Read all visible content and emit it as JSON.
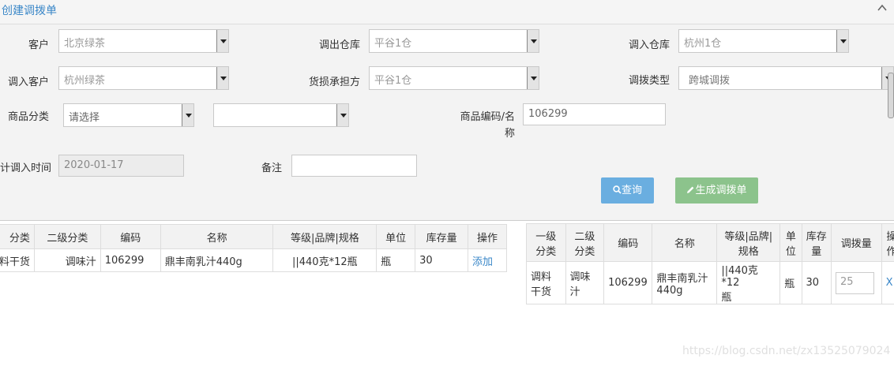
{
  "panel": {
    "title": "创建调拨单",
    "collapse_icon": "chevron-up-icon"
  },
  "form": {
    "customer": {
      "label": "客户",
      "value": "北京绿茶"
    },
    "out_warehouse": {
      "label": "调出仓库",
      "value": "平谷1仓"
    },
    "in_warehouse": {
      "label": "调入仓库",
      "value": "杭州1仓"
    },
    "in_customer": {
      "label": "调入客户",
      "value": "杭州绿茶"
    },
    "loss_bearer": {
      "label": "货损承担方",
      "value": "平谷1仓"
    },
    "transfer_type": {
      "label": "调拨类型",
      "value": "跨城调拨"
    },
    "category": {
      "label": "商品分类",
      "value": "请选择",
      "sub_value": ""
    },
    "code_name": {
      "label_line1": "商品编码/名",
      "label_line2": "称",
      "value": "106299"
    },
    "plan_time": {
      "label": "计调入时间",
      "value": "2020-01-17"
    },
    "remark": {
      "label": "备注",
      "value": ""
    }
  },
  "buttons": {
    "query": "查询",
    "generate": "生成调拨单"
  },
  "left_table": {
    "headers": [
      "分类",
      "二级分类",
      "编码",
      "名称",
      "等级|品牌|规格",
      "单位",
      "库存量",
      "操作"
    ],
    "rows": [
      {
        "cat1": "料干货",
        "cat2": "调味汁",
        "code": "106299",
        "name": "鼎丰南乳汁440g",
        "spec": "||440克*12瓶",
        "unit": "瓶",
        "stock": "30",
        "action": "添加"
      }
    ]
  },
  "right_table": {
    "headers": [
      [
        "一级",
        "分类"
      ],
      [
        "二级",
        "分类"
      ],
      [
        "编码"
      ],
      [
        "名称"
      ],
      [
        "等级|品牌|",
        "规格"
      ],
      [
        "单",
        "位"
      ],
      [
        "库存",
        "量"
      ],
      [
        "调拨量"
      ],
      [
        "操",
        "作"
      ]
    ],
    "rows": [
      {
        "cat1": [
          "调料",
          "干货"
        ],
        "cat2": [
          "调味",
          "汁"
        ],
        "code": "106299",
        "name": [
          "鼎丰南乳汁",
          "440g"
        ],
        "spec": [
          "||440克*12",
          "瓶"
        ],
        "unit": "瓶",
        "stock": "30",
        "qty": "25",
        "action": "X"
      }
    ]
  },
  "watermark": "https://blog.csdn.net/zx13525079024"
}
